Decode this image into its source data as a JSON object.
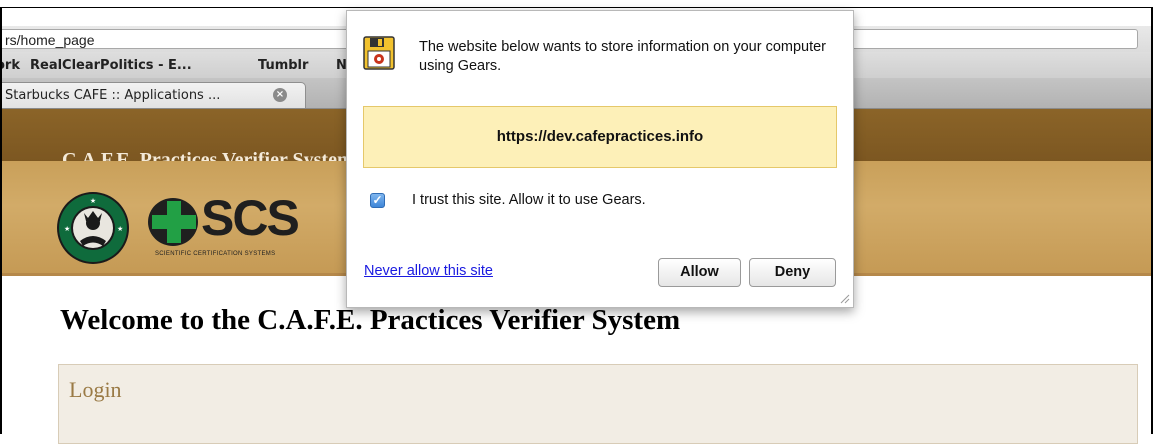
{
  "browser": {
    "title_fragment": "Starbucks CAFE :: Applications you have access to",
    "url": "rs/home_page",
    "bookmarks": [
      "ork",
      "RealClearPolitics - E...",
      "Tumblr",
      "N"
    ],
    "tab_title": "Starbucks CAFE :: Applications ..."
  },
  "site": {
    "header_title": "C.A.F.E. Practices Verifier System",
    "scs_logo_text": "SCS",
    "scs_logo_subtitle": "SCIENTIFIC CERTIFICATION SYSTEMS",
    "starbucks_logo_text": "STARBUCKS COFFEE",
    "welcome": "Welcome to the C.A.F.E. Practices Verifier System",
    "login_title": "Login"
  },
  "dialog": {
    "message": "The website below wants to store information on your computer using Gears.",
    "origin": "https://dev.cafepractices.info",
    "trust_label": "I trust this site. Allow it to use Gears.",
    "trust_checked": true,
    "never_link": "Never allow this site",
    "allow_label": "Allow",
    "deny_label": "Deny"
  },
  "colors": {
    "header_brown": "#7a5520",
    "band_tan": "#c9a05a",
    "origin_yellow": "#fdf0b8",
    "link_blue": "#1a1ae0"
  },
  "icons": [
    "gears-floppy-icon",
    "tab-close-icon",
    "checkbox-icon",
    "resize-grip-icon"
  ]
}
